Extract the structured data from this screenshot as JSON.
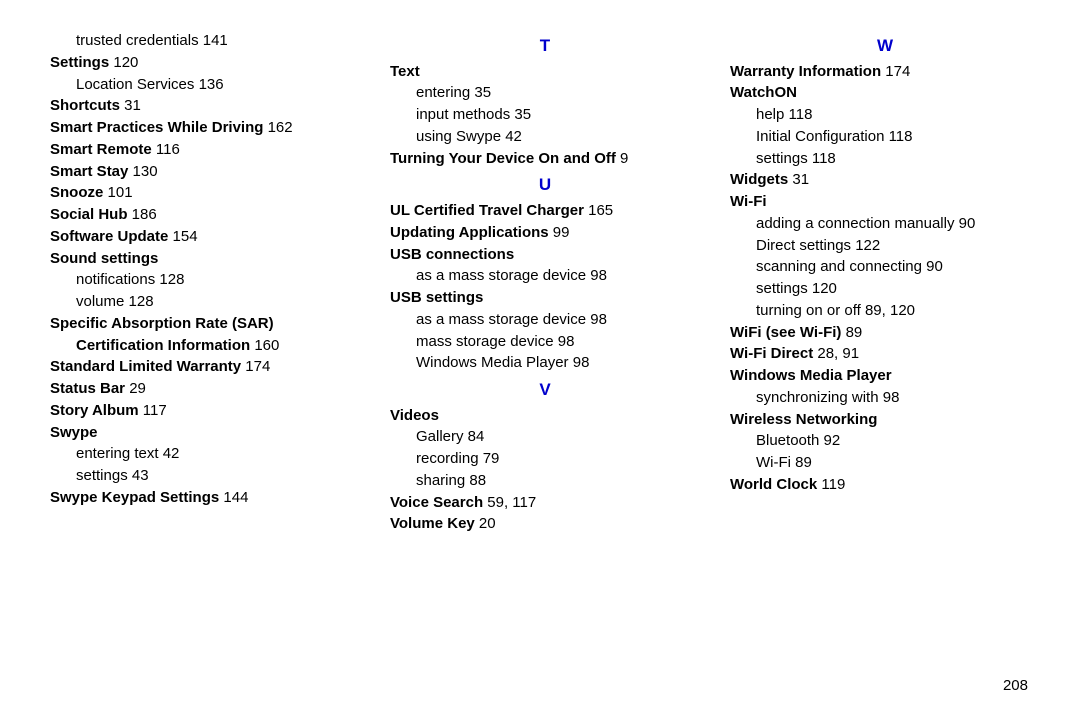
{
  "page_number": "208",
  "columns": [
    {
      "entries": [
        {
          "type": "sub",
          "text": "trusted credentials 141"
        },
        {
          "type": "topic",
          "bold_label": "Settings",
          "page": "120"
        },
        {
          "type": "sub",
          "text": "Location Services 136"
        },
        {
          "type": "topic",
          "bold_label": "Shortcuts",
          "page": "31"
        },
        {
          "type": "topic",
          "bold_label": "Smart Practices While Driving",
          "page": "162"
        },
        {
          "type": "topic",
          "bold_label": "Smart Remote",
          "page": "116"
        },
        {
          "type": "topic",
          "bold_label": "Smart Stay",
          "page": "130"
        },
        {
          "type": "topic",
          "bold_label": "Snooze",
          "page": "101"
        },
        {
          "type": "topic",
          "bold_label": "Social Hub",
          "page": "186"
        },
        {
          "type": "topic",
          "bold_label": "Software Update",
          "page": "154"
        },
        {
          "type": "topic",
          "bold_label": "Sound settings",
          "page": ""
        },
        {
          "type": "sub",
          "text": "notifications 128"
        },
        {
          "type": "sub",
          "text": "volume 128"
        },
        {
          "type": "topic",
          "bold_label": "Specific Absorption Rate (SAR) Certification Information",
          "page": "160"
        },
        {
          "type": "topic",
          "bold_label": "Standard Limited Warranty",
          "page": "174"
        },
        {
          "type": "topic",
          "bold_label": "Status Bar",
          "page": "29"
        },
        {
          "type": "topic",
          "bold_label": "Story Album",
          "page": "117"
        },
        {
          "type": "topic",
          "bold_label": "Swype",
          "page": ""
        },
        {
          "type": "sub",
          "text": "entering text 42"
        },
        {
          "type": "sub",
          "text": "settings 43"
        },
        {
          "type": "topic",
          "bold_label": "Swype Keypad Settings",
          "page": "144"
        }
      ]
    },
    {
      "entries": [
        {
          "type": "letter",
          "text": "T"
        },
        {
          "type": "topic",
          "bold_label": "Text",
          "page": ""
        },
        {
          "type": "sub",
          "text": "entering 35"
        },
        {
          "type": "sub",
          "text": "input methods 35"
        },
        {
          "type": "sub",
          "text": "using Swype 42"
        },
        {
          "type": "topic",
          "bold_label": "Turning Your Device On and Off",
          "page": "9"
        },
        {
          "type": "letter",
          "text": "U"
        },
        {
          "type": "topic",
          "bold_label": "UL Certified Travel Charger",
          "page": "165"
        },
        {
          "type": "topic",
          "bold_label": "Updating Applications",
          "page": "99"
        },
        {
          "type": "topic",
          "bold_label": "USB connections",
          "page": ""
        },
        {
          "type": "sub",
          "text": "as a mass storage device 98"
        },
        {
          "type": "topic",
          "bold_label": "USB settings",
          "page": ""
        },
        {
          "type": "sub",
          "text": "as a mass storage device 98"
        },
        {
          "type": "sub",
          "text": "mass storage device 98"
        },
        {
          "type": "sub",
          "text": "Windows Media Player 98"
        },
        {
          "type": "letter",
          "text": "V"
        },
        {
          "type": "topic",
          "bold_label": "Videos",
          "page": ""
        },
        {
          "type": "sub",
          "text": "Gallery 84"
        },
        {
          "type": "sub",
          "text": "recording 79"
        },
        {
          "type": "sub",
          "text": "sharing 88"
        },
        {
          "type": "topic",
          "bold_label": "Voice Search",
          "page": "59, 117"
        },
        {
          "type": "topic",
          "bold_label": "Volume Key",
          "page": "20"
        }
      ]
    },
    {
      "entries": [
        {
          "type": "letter",
          "text": "W"
        },
        {
          "type": "topic",
          "bold_label": "Warranty Information",
          "page": "174"
        },
        {
          "type": "topic",
          "bold_label": "WatchON",
          "page": ""
        },
        {
          "type": "sub",
          "text": "help 118"
        },
        {
          "type": "sub",
          "text": "Initial Configuration 118"
        },
        {
          "type": "sub",
          "text": "settings 118"
        },
        {
          "type": "topic",
          "bold_label": "Widgets",
          "page": "31"
        },
        {
          "type": "topic",
          "bold_label": "Wi-Fi",
          "page": ""
        },
        {
          "type": "sub",
          "text": "adding a connection manually 90"
        },
        {
          "type": "sub",
          "text": "Direct settings 122"
        },
        {
          "type": "sub",
          "text": "scanning and connecting 90"
        },
        {
          "type": "sub",
          "text": "settings 120"
        },
        {
          "type": "sub",
          "text": "turning on or off 89, 120"
        },
        {
          "type": "topic",
          "bold_label": "WiFi (see Wi-Fi)",
          "page": "89"
        },
        {
          "type": "topic",
          "bold_label": "Wi-Fi Direct",
          "page": "28, 91"
        },
        {
          "type": "topic",
          "bold_label": "Windows Media Player",
          "page": ""
        },
        {
          "type": "sub",
          "text": "synchronizing with 98"
        },
        {
          "type": "topic",
          "bold_label": "Wireless Networking",
          "page": ""
        },
        {
          "type": "sub",
          "text": "Bluetooth 92"
        },
        {
          "type": "sub",
          "text": "Wi-Fi 89"
        },
        {
          "type": "topic",
          "bold_label": "World Clock",
          "page": "119"
        }
      ]
    }
  ]
}
